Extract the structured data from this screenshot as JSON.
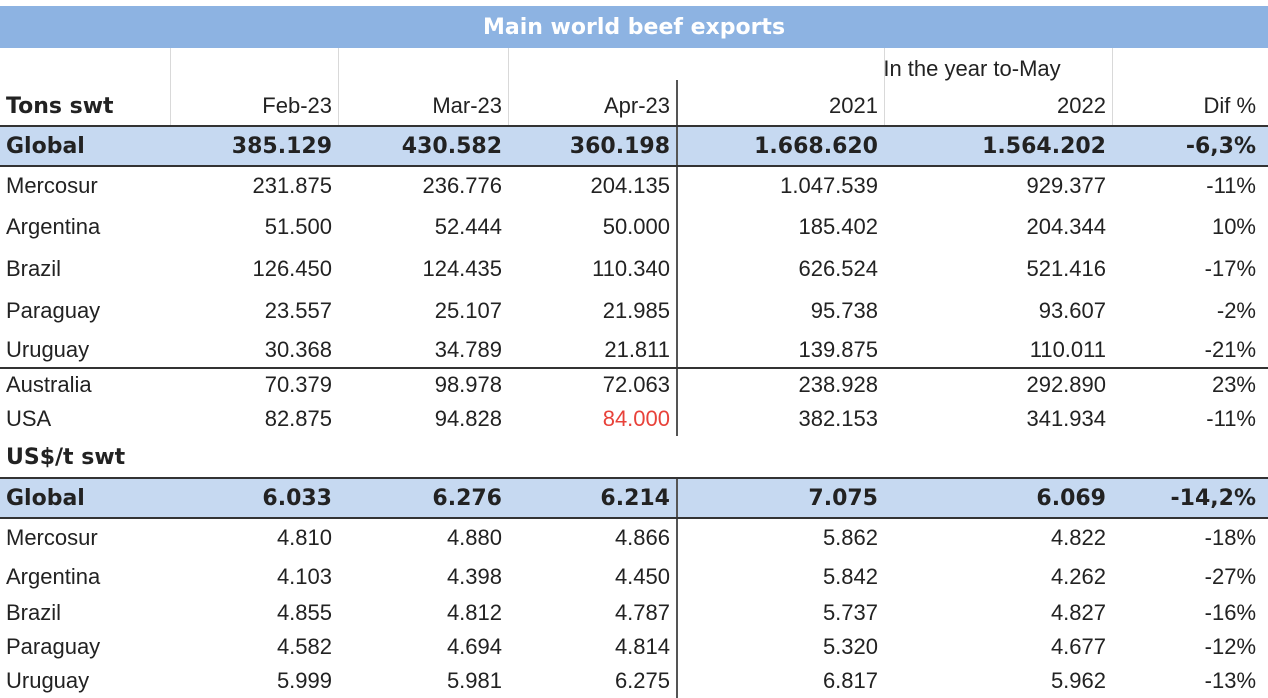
{
  "title": "Main world beef exports",
  "ytd_label": "In the year to-May",
  "headers": [
    "Tons swt",
    "Feb-23",
    "Mar-23",
    "Apr-23",
    "2021",
    "2022",
    "Dif %"
  ],
  "sections": [
    {
      "unit_label": "",
      "rows": [
        {
          "name": "Global",
          "values": [
            "385.129",
            "430.582",
            "360.198",
            "1.668.620",
            "1.564.202",
            "-6,3%"
          ],
          "total": true
        },
        {
          "name": "Mercosur",
          "values": [
            "231.875",
            "236.776",
            "204.135",
            "1.047.539",
            "929.377",
            "-11%"
          ]
        },
        {
          "name": "Argentina",
          "values": [
            "51.500",
            "52.444",
            "50.000",
            "185.402",
            "204.344",
            "10%"
          ]
        },
        {
          "name": "Brazil",
          "values": [
            "126.450",
            "124.435",
            "110.340",
            "626.524",
            "521.416",
            "-17%"
          ]
        },
        {
          "name": "Paraguay",
          "values": [
            "23.557",
            "25.107",
            "21.985",
            "95.738",
            "93.607",
            "-2%"
          ]
        },
        {
          "name": "Uruguay",
          "values": [
            "30.368",
            "34.789",
            "21.811",
            "139.875",
            "110.011",
            "-21%"
          ]
        },
        {
          "name": "Australia",
          "values": [
            "70.379",
            "98.978",
            "72.063",
            "238.928",
            "292.890",
            "23%"
          ]
        },
        {
          "name": "USA",
          "values": [
            "82.875",
            "94.828",
            "84.000",
            "382.153",
            "341.934",
            "-11%"
          ],
          "highlight_col": 2
        }
      ]
    },
    {
      "unit_label": "US$/t swt",
      "rows": [
        {
          "name": "Global",
          "values": [
            "6.033",
            "6.276",
            "6.214",
            "7.075",
            "6.069",
            "-14,2%"
          ],
          "total": true
        },
        {
          "name": "Mercosur",
          "values": [
            "4.810",
            "4.880",
            "4.866",
            "5.862",
            "4.822",
            "-18%"
          ]
        },
        {
          "name": "Argentina",
          "values": [
            "4.103",
            "4.398",
            "4.450",
            "5.842",
            "4.262",
            "-27%"
          ]
        },
        {
          "name": "Brazil",
          "values": [
            "4.855",
            "4.812",
            "4.787",
            "5.737",
            "4.827",
            "-16%"
          ]
        },
        {
          "name": "Paraguay",
          "values": [
            "4.582",
            "4.694",
            "4.814",
            "5.320",
            "4.677",
            "-12%"
          ]
        },
        {
          "name": "Uruguay",
          "values": [
            "5.999",
            "5.981",
            "6.275",
            "6.817",
            "5.962",
            "-13%"
          ]
        }
      ]
    }
  ],
  "colors": {
    "title_bg": "#8db3e2",
    "total_row_bg": "#c6d9f1",
    "highlight": "#e8423a"
  },
  "chart_data": {
    "type": "table",
    "title": "Main world beef exports",
    "columns": [
      "Tons swt",
      "Feb-23",
      "Mar-23",
      "Apr-23",
      "2021",
      "2022",
      "Dif %"
    ],
    "column_group": {
      "label": "In the year to-May",
      "columns": [
        "2021",
        "2022",
        "Dif %"
      ]
    },
    "tables": [
      {
        "unit": "Tons swt",
        "rows": [
          [
            "Global",
            385129,
            430582,
            360198,
            1668620,
            1564202,
            -6.3
          ],
          [
            "Mercosur",
            231875,
            236776,
            204135,
            1047539,
            929377,
            -11
          ],
          [
            "Argentina",
            51500,
            52444,
            50000,
            185402,
            204344,
            10
          ],
          [
            "Brazil",
            126450,
            124435,
            110340,
            626524,
            521416,
            -17
          ],
          [
            "Paraguay",
            23557,
            25107,
            21985,
            95738,
            93607,
            -2
          ],
          [
            "Uruguay",
            30368,
            34789,
            21811,
            139875,
            110011,
            -21
          ],
          [
            "Australia",
            70379,
            98978,
            72063,
            238928,
            292890,
            23
          ],
          [
            "USA",
            82875,
            94828,
            84000,
            382153,
            341934,
            -11
          ]
        ]
      },
      {
        "unit": "US$/t swt",
        "rows": [
          [
            "Global",
            6033,
            6276,
            6214,
            7075,
            6069,
            -14.2
          ],
          [
            "Mercosur",
            4810,
            4880,
            4866,
            5862,
            4822,
            -18
          ],
          [
            "Argentina",
            4103,
            4398,
            4450,
            5842,
            4262,
            -27
          ],
          [
            "Brazil",
            4855,
            4812,
            4787,
            5737,
            4827,
            -16
          ],
          [
            "Paraguay",
            4582,
            4694,
            4814,
            5320,
            4677,
            -12
          ],
          [
            "Uruguay",
            5999,
            5981,
            6275,
            6817,
            5962,
            -13
          ]
        ]
      }
    ]
  }
}
